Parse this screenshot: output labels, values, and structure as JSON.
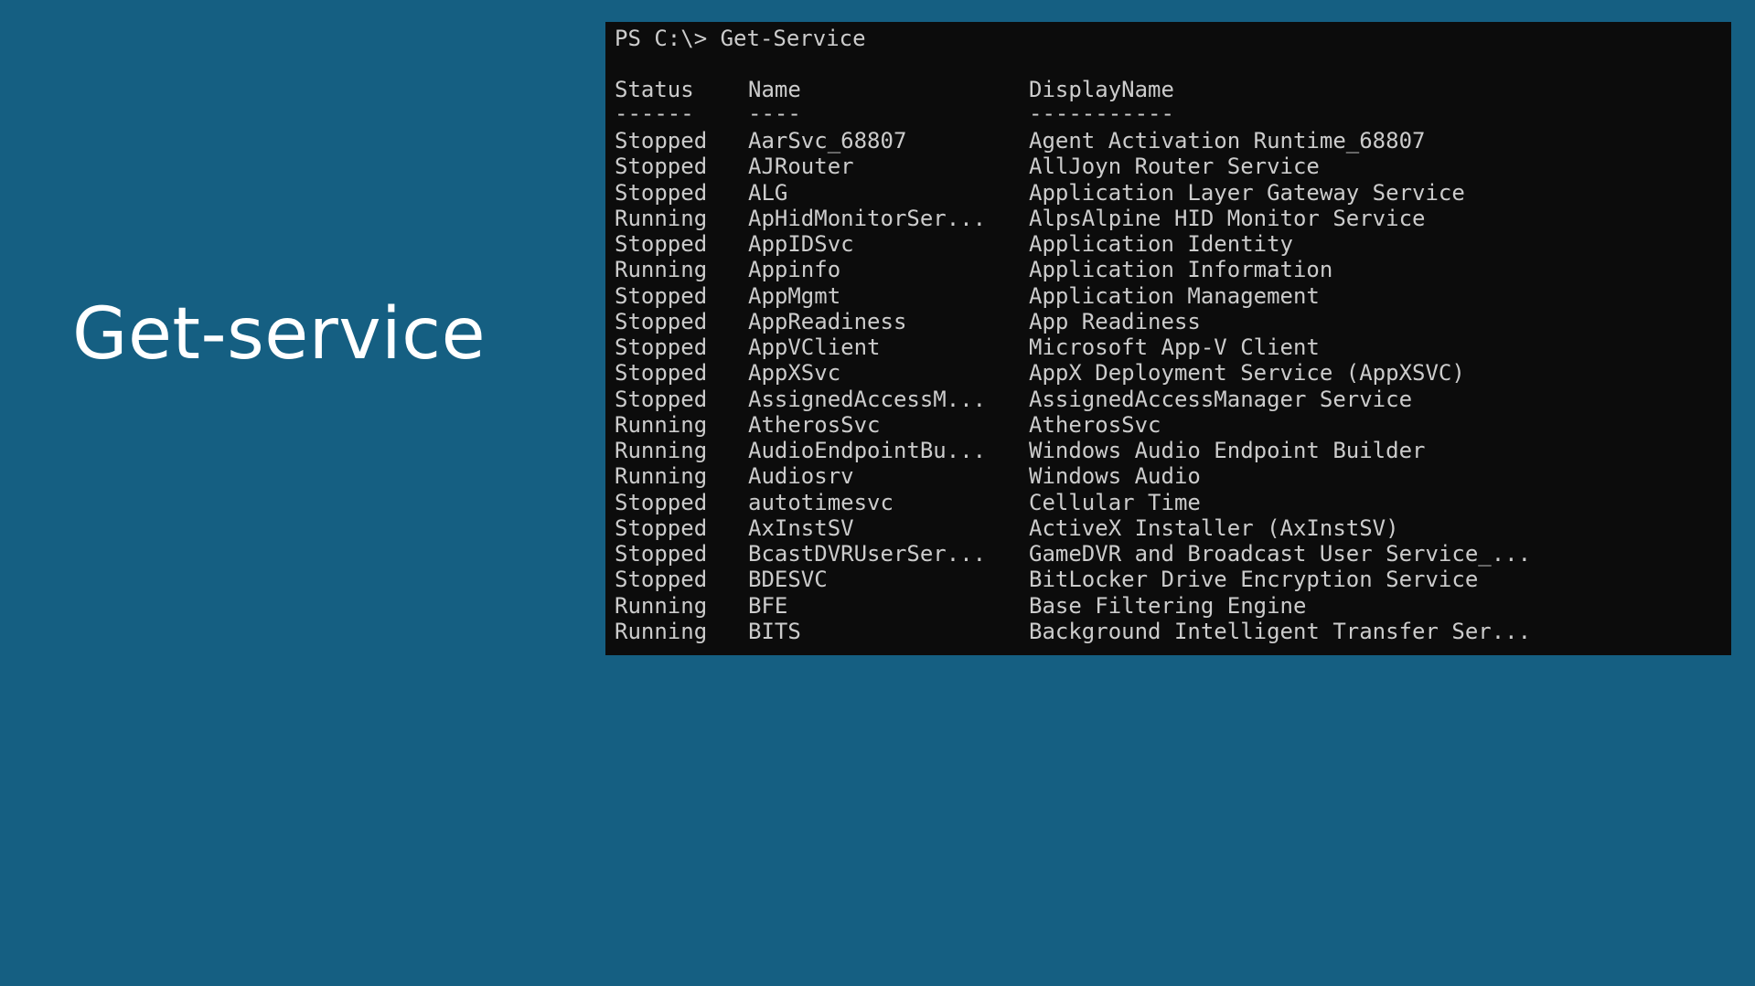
{
  "slide": {
    "title": "Get-service"
  },
  "terminal": {
    "prompt": "PS C:\\> Get-Service",
    "headers": {
      "status": "Status",
      "name": "Name",
      "display_name": "DisplayName"
    },
    "separators": {
      "status": "------",
      "name": "----",
      "display_name": "-----------"
    },
    "rows": [
      {
        "status": "Stopped",
        "name": "AarSvc_68807",
        "display_name": "Agent Activation Runtime_68807"
      },
      {
        "status": "Stopped",
        "name": "AJRouter",
        "display_name": "AllJoyn Router Service"
      },
      {
        "status": "Stopped",
        "name": "ALG",
        "display_name": "Application Layer Gateway Service"
      },
      {
        "status": "Running",
        "name": "ApHidMonitorSer...",
        "display_name": "AlpsAlpine HID Monitor Service"
      },
      {
        "status": "Stopped",
        "name": "AppIDSvc",
        "display_name": "Application Identity"
      },
      {
        "status": "Running",
        "name": "Appinfo",
        "display_name": "Application Information"
      },
      {
        "status": "Stopped",
        "name": "AppMgmt",
        "display_name": "Application Management"
      },
      {
        "status": "Stopped",
        "name": "AppReadiness",
        "display_name": "App Readiness"
      },
      {
        "status": "Stopped",
        "name": "AppVClient",
        "display_name": "Microsoft App-V Client"
      },
      {
        "status": "Stopped",
        "name": "AppXSvc",
        "display_name": "AppX Deployment Service (AppXSVC)"
      },
      {
        "status": "Stopped",
        "name": "AssignedAccessM...",
        "display_name": "AssignedAccessManager Service"
      },
      {
        "status": "Running",
        "name": "AtherosSvc",
        "display_name": "AtherosSvc"
      },
      {
        "status": "Running",
        "name": "AudioEndpointBu...",
        "display_name": "Windows Audio Endpoint Builder"
      },
      {
        "status": "Running",
        "name": "Audiosrv",
        "display_name": "Windows Audio"
      },
      {
        "status": "Stopped",
        "name": "autotimesvc",
        "display_name": "Cellular Time"
      },
      {
        "status": "Stopped",
        "name": "AxInstSV",
        "display_name": "ActiveX Installer (AxInstSV)"
      },
      {
        "status": "Stopped",
        "name": "BcastDVRUserSer...",
        "display_name": "GameDVR and Broadcast User Service_..."
      },
      {
        "status": "Stopped",
        "name": "BDESVC",
        "display_name": "BitLocker Drive Encryption Service"
      },
      {
        "status": "Running",
        "name": "BFE",
        "display_name": "Base Filtering Engine"
      },
      {
        "status": "Running",
        "name": "BITS",
        "display_name": "Background Intelligent Transfer Ser..."
      }
    ]
  },
  "colors": {
    "background": "#155f82",
    "terminal_background": "#0c0c0c",
    "terminal_text": "#cccccc",
    "title_text": "#ffffff"
  }
}
